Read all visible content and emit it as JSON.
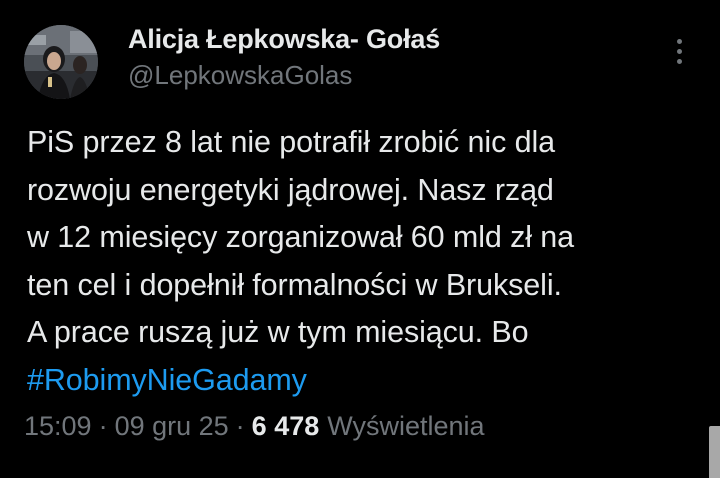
{
  "author": {
    "display_name": "Alicja Łepkowska- Gołaś",
    "handle": "@LepkowskaGolas"
  },
  "tweet": {
    "lines": [
      "PiS przez 8 lat nie potrafił zrobić nic dla",
      "rozwoju energetyki jądrowej. Nasz rząd",
      "w 12 miesięcy zorganizował 60 mld zł na",
      "ten cel i dopełnił formalności w Brukseli.",
      "A prace ruszą już w tym miesiącu. Bo"
    ],
    "hashtag": "#RobimyNieGadamy"
  },
  "meta": {
    "time": "15:09",
    "separator": "·",
    "date": "09 gru 25",
    "views_count": "6 478",
    "views_label": "Wyświetlenia"
  },
  "icons": {
    "more": "more-horizontal-icon"
  },
  "colors": {
    "background": "#000000",
    "text_primary": "#e7e9ea",
    "text_secondary": "#71767b",
    "accent": "#1d9bf0"
  }
}
